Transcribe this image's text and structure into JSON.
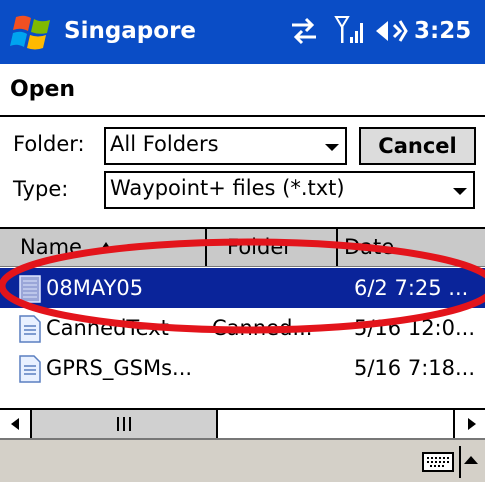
{
  "titlebar": {
    "title": "Singapore",
    "clock": "3:25"
  },
  "header": {
    "title": "Open"
  },
  "form": {
    "folder_label": "Folder:",
    "folder_value": "All Folders",
    "type_label": "Type:",
    "type_value": "Waypoint+ files (*.txt)",
    "cancel_label": "Cancel"
  },
  "list": {
    "columns": [
      "Name",
      "Folder",
      "Date"
    ],
    "rows": [
      {
        "name": "08MAY05",
        "folder": "",
        "date": "6/2 7:25 ...",
        "selected": true
      },
      {
        "name": "CannedText",
        "folder": "Canned...",
        "date": "5/16 12:0..."
      },
      {
        "name": "GPRS_GSMs...",
        "folder": "",
        "date": "5/16 7:18..."
      }
    ]
  },
  "colors": {
    "titlebar": "#0a4dc6",
    "selection": "#0a249a",
    "highlight": "#e3141b"
  },
  "icons": {
    "start": "windows-flag-icon",
    "connectivity": "connectivity-arrows-icon",
    "signal": "signal-strength-icon",
    "volume": "volume-icon",
    "keyboard": "keyboard-icon"
  }
}
